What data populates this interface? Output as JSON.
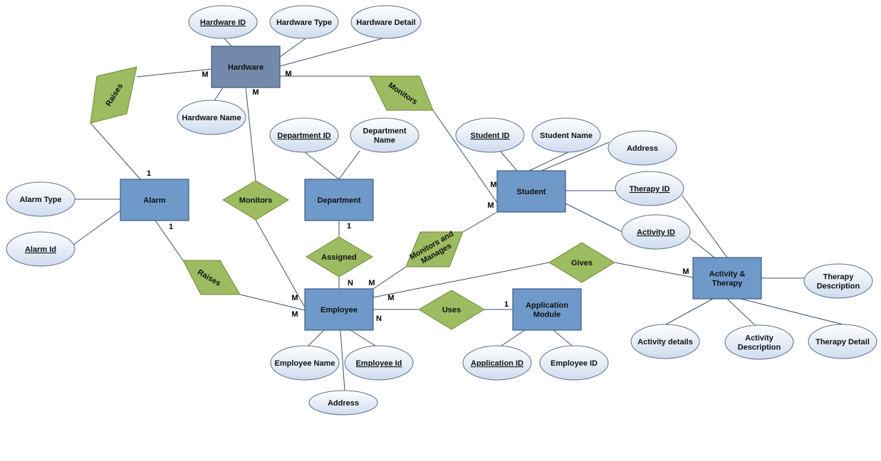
{
  "diagram": {
    "type": "entity-relationship",
    "colors": {
      "entity_fill": "#6f99c9",
      "entity_fill_dark": "#7389aa",
      "relationship_fill": "#9dbb61",
      "attribute_fill_top": "#ffffff",
      "attribute_fill_bottom": "#d3dff0",
      "line": "#3a4f6e"
    },
    "entities": [
      {
        "id": "hardware",
        "label": "Hardware",
        "dark": true
      },
      {
        "id": "alarm",
        "label": "Alarm"
      },
      {
        "id": "department",
        "label": "Department"
      },
      {
        "id": "student",
        "label": "Student"
      },
      {
        "id": "employee",
        "label": "Employee"
      },
      {
        "id": "application",
        "label": "Application Module"
      },
      {
        "id": "activity",
        "label": "Activity & Therapy"
      }
    ],
    "relationships": [
      {
        "id": "raises1",
        "label": "Raises"
      },
      {
        "id": "monitors1",
        "label": "Monitors"
      },
      {
        "id": "monitors2",
        "label": "Monitors"
      },
      {
        "id": "assigned",
        "label": "Assigned"
      },
      {
        "id": "monmanages",
        "label": "Monitors and Manages"
      },
      {
        "id": "raises2",
        "label": "Raises"
      },
      {
        "id": "gives",
        "label": "Gives"
      },
      {
        "id": "uses",
        "label": "Uses"
      }
    ],
    "attributes": [
      {
        "id": "hw_id",
        "label": "Hardware ID",
        "key": true
      },
      {
        "id": "hw_type",
        "label": "Hardware Type"
      },
      {
        "id": "hw_detail",
        "label": "Hardware Detail"
      },
      {
        "id": "hw_name",
        "label": "Hardware Name"
      },
      {
        "id": "alarm_type",
        "label": "Alarm Type"
      },
      {
        "id": "alarm_id",
        "label": "Alarm Id",
        "key": true
      },
      {
        "id": "dept_id",
        "label": "Department ID",
        "key": true
      },
      {
        "id": "dept_name",
        "label": "Department Name"
      },
      {
        "id": "stu_id",
        "label": "Student ID",
        "key": true
      },
      {
        "id": "stu_name",
        "label": "Student Name"
      },
      {
        "id": "stu_addr",
        "label": "Address"
      },
      {
        "id": "therapy_id",
        "label": "Therapy ID",
        "key": true
      },
      {
        "id": "activity_id",
        "label": "Activity ID",
        "key": true
      },
      {
        "id": "therapy_desc",
        "label": "Therapy Description"
      },
      {
        "id": "activity_details",
        "label": "Activity details"
      },
      {
        "id": "activity_desc",
        "label": "Activity Description"
      },
      {
        "id": "therapy_detail",
        "label": "Therapy Detail"
      },
      {
        "id": "emp_name",
        "label": "Employee Name"
      },
      {
        "id": "emp_id",
        "label": "Employee Id",
        "key": true
      },
      {
        "id": "emp_addr",
        "label": "Address"
      },
      {
        "id": "app_id",
        "label": "Application ID",
        "key": true
      },
      {
        "id": "app_emp_id",
        "label": "Employee ID"
      }
    ],
    "cardinalities": [
      {
        "id": "c_hw_raises",
        "label": "M"
      },
      {
        "id": "c_hw_monitors2",
        "label": "M"
      },
      {
        "id": "c_hw_monitors1",
        "label": "M"
      },
      {
        "id": "c_alarm_raises1",
        "label": "1"
      },
      {
        "id": "c_alarm_raises2",
        "label": "1"
      },
      {
        "id": "c_dept_assigned",
        "label": "1"
      },
      {
        "id": "c_emp_assigned",
        "label": "N"
      },
      {
        "id": "c_emp_monmanages",
        "label": "M"
      },
      {
        "id": "c_emp_monitors1",
        "label": "M"
      },
      {
        "id": "c_emp_raises2",
        "label": "M"
      },
      {
        "id": "c_emp_gives",
        "label": "M"
      },
      {
        "id": "c_emp_uses",
        "label": "N"
      },
      {
        "id": "c_app_uses",
        "label": "1"
      },
      {
        "id": "c_stu_monitors2",
        "label": "M"
      },
      {
        "id": "c_stu_monmanages",
        "label": "M"
      },
      {
        "id": "c_act_gives",
        "label": "M"
      }
    ]
  }
}
